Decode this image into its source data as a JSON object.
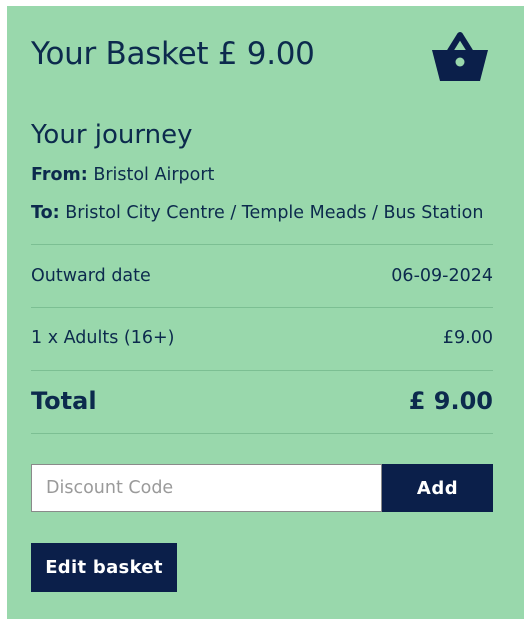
{
  "basket": {
    "title_prefix": "Your Basket",
    "total_amount": "£ 9.00",
    "icon": "shopping-basket-icon"
  },
  "journey": {
    "title": "Your journey",
    "from_label": "From:",
    "from_value": "Bristol Airport",
    "to_label": "To:",
    "to_value": "Bristol City Centre / Temple Meads / Bus Station"
  },
  "summary": {
    "outward_label": "Outward date",
    "outward_value": "06-09-2024",
    "ticket_label": "1 x Adults (16+)",
    "ticket_price": "£9.00",
    "total_label": "Total",
    "total_value": "£ 9.00"
  },
  "discount": {
    "placeholder": "Discount Code",
    "value": "",
    "add_label": "Add"
  },
  "actions": {
    "edit_label": "Edit basket"
  },
  "colors": {
    "panel": "#99d8ac",
    "navy": "#0b1f4a",
    "text": "#0c2a4d"
  }
}
